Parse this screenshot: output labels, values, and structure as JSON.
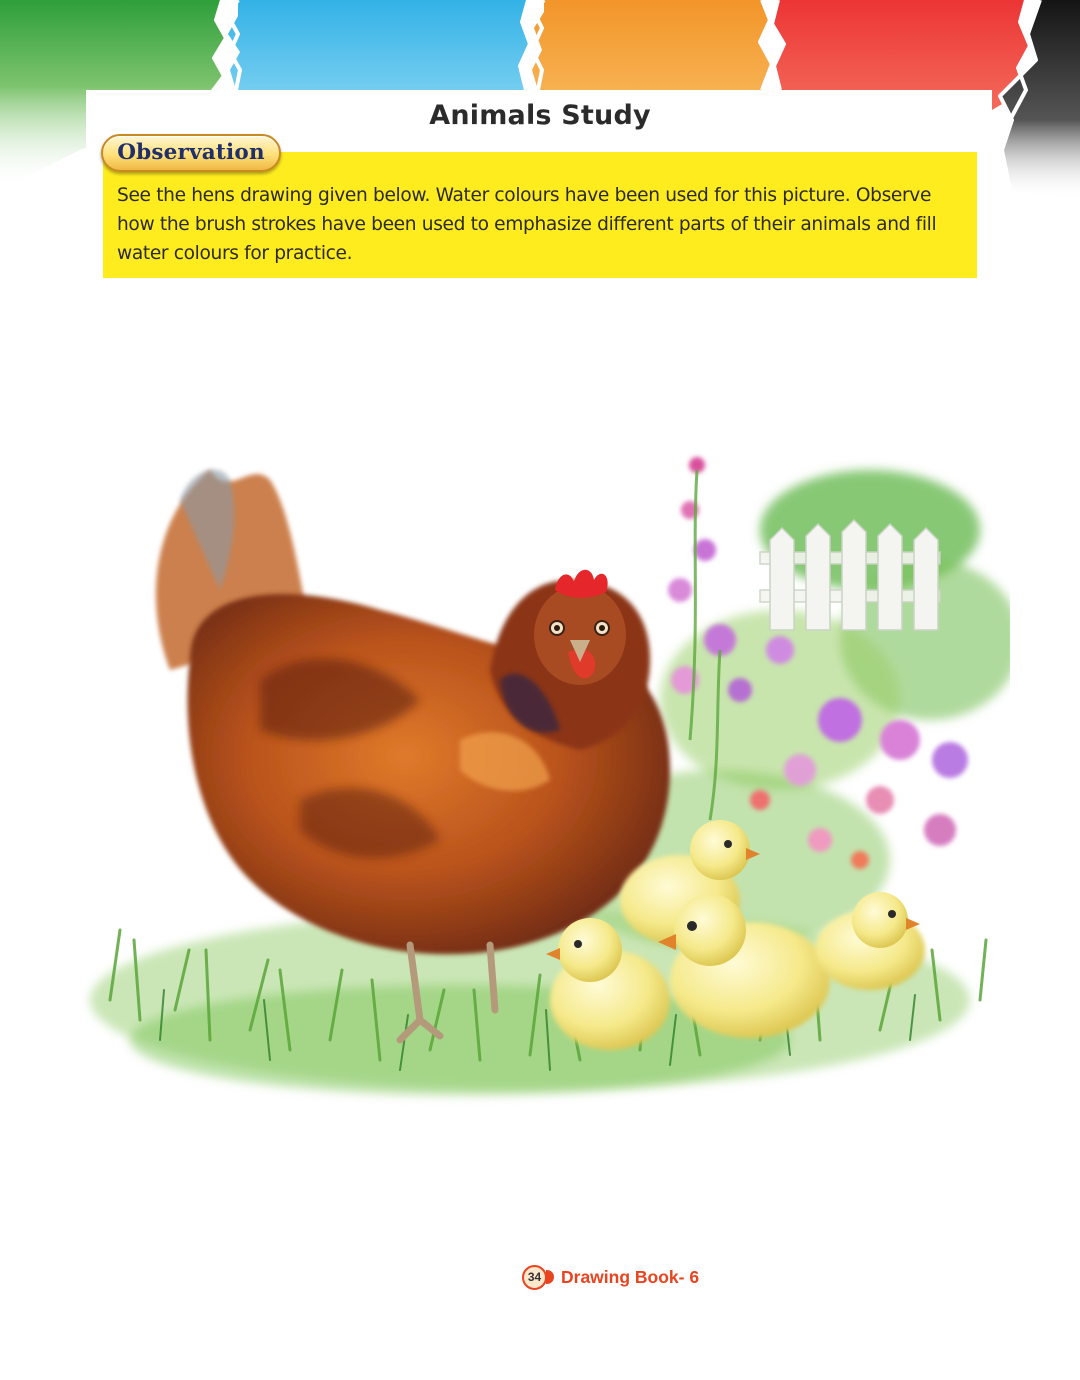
{
  "page": {
    "title": "Animals Study",
    "observation_label": "Observation",
    "observation_text": "See the hens drawing given below. Water colours have been used for this picture. Observe how the brush strokes have been used to emphasize different parts of their animals and fill water colours for practice."
  },
  "footer": {
    "page_number": "34",
    "book_title": "Drawing Book- 6"
  },
  "colors": {
    "banner": [
      "#3fb24a",
      "#3db9e8",
      "#f39a2a",
      "#ef3f3f",
      "#1c1c1c"
    ],
    "observation_box": "#ffec1f",
    "accent": "#e8441f"
  },
  "illustration": {
    "subject": "hen with four chicks in grass beside a flower garden and white picket fence",
    "style": "watercolour"
  }
}
